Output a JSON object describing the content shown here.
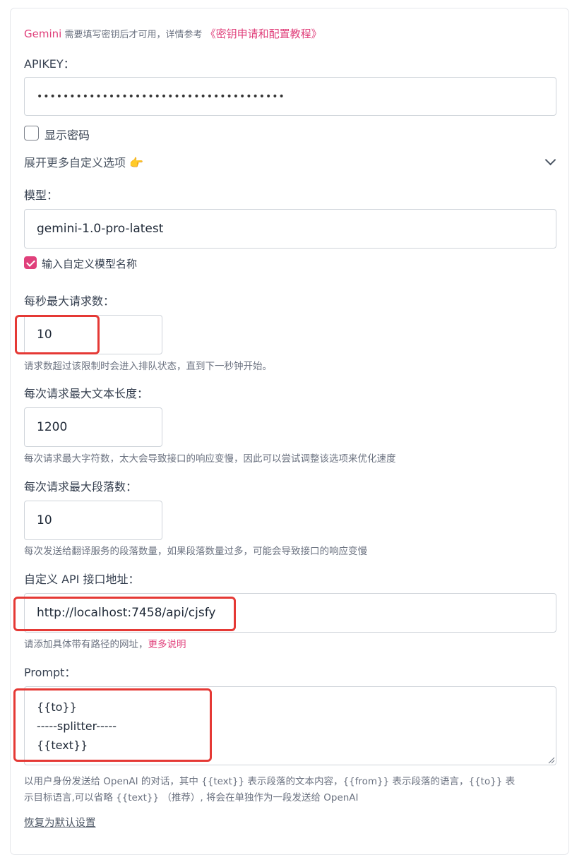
{
  "intro": {
    "brand": "Gemini",
    "text": " 需要填写密钥后才可用，详情参考 ",
    "link": "《密钥申请和配置教程》"
  },
  "apikey": {
    "label": "APIKEY：",
    "value": "••••••••••••••••••••••••••••••••••••••"
  },
  "show_password": {
    "label": "显示密码",
    "checked": false
  },
  "expand": {
    "label": "展开更多自定义选项 👉",
    "icon": "chevron-down-icon"
  },
  "model": {
    "label": "模型：",
    "value": "gemini-1.0-pro-latest",
    "custom_checkbox_label": "输入自定义模型名称",
    "custom_checked": true
  },
  "rps": {
    "label": "每秒最大请求数：",
    "value": "10",
    "help": "请求数超过该限制时会进入排队状态，直到下一秒钟开始。"
  },
  "max_text_len": {
    "label": "每次请求最大文本长度：",
    "value": "1200",
    "help": "每次请求最大字符数，太大会导致接口的响应变慢，因此可以尝试调整该选项来优化速度"
  },
  "max_paragraphs": {
    "label": "每次请求最大段落数：",
    "value": "10",
    "help": "每次发送给翻译服务的段落数量，如果段落数量过多，可能会导致接口的响应变慢"
  },
  "api_url": {
    "label": "自定义 API 接口地址：",
    "value": "http://localhost:7458/api/cjsfy",
    "help": "请添加具体带有路径的网址，",
    "help_link": "更多说明"
  },
  "prompt": {
    "label": "Prompt：",
    "value": "{{to}}\n-----splitter-----\n{{text}}",
    "help_line1": "以用户身份发送给 OpenAI 的对话，其中 {{text}} 表示段落的文本内容，{{from}} 表示段落的语言，{{to}} 表",
    "help_line2": "示目标语言,可以省略 {{text}} （推荐）, 将会在单独作为一段发送给 OpenAI"
  },
  "reset_label": "恢复为默认设置",
  "colors": {
    "accent": "#e0407b",
    "annotation": "#e53935"
  }
}
